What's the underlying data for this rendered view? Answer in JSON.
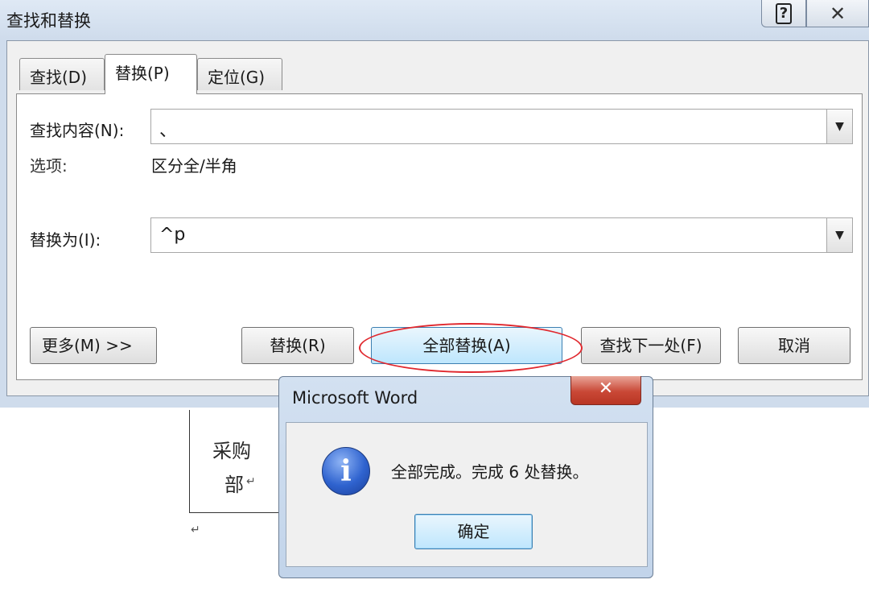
{
  "window": {
    "title": "查找和替换",
    "help_glyph": "?",
    "close_glyph": "✕"
  },
  "tabs": [
    {
      "label": "查找(D)",
      "active": false
    },
    {
      "label": "替换(P)",
      "active": true
    },
    {
      "label": "定位(G)",
      "active": false
    }
  ],
  "form": {
    "find_label": "查找内容(N):",
    "find_value": "、",
    "options_label": "选项:",
    "options_value": "区分全/半角",
    "replace_label": "替换为(I):",
    "replace_value": "^p",
    "dropdown_glyph": "▼"
  },
  "buttons": {
    "more": "更多(M) >>",
    "replace": "替换(R)",
    "replace_all": "全部替换(A)",
    "find_next": "查找下一处(F)",
    "cancel": "取消"
  },
  "document": {
    "cell_line1": "采购",
    "cell_line2": "部",
    "para_mark": "↵"
  },
  "message_box": {
    "title": "Microsoft Word",
    "close_glyph": "✕",
    "icon_glyph": "i",
    "text": "全部完成。完成 6 处替换。",
    "ok_label": "确定"
  },
  "colors": {
    "highlight": "#e0282e",
    "title_bar": "#cfdcec"
  }
}
